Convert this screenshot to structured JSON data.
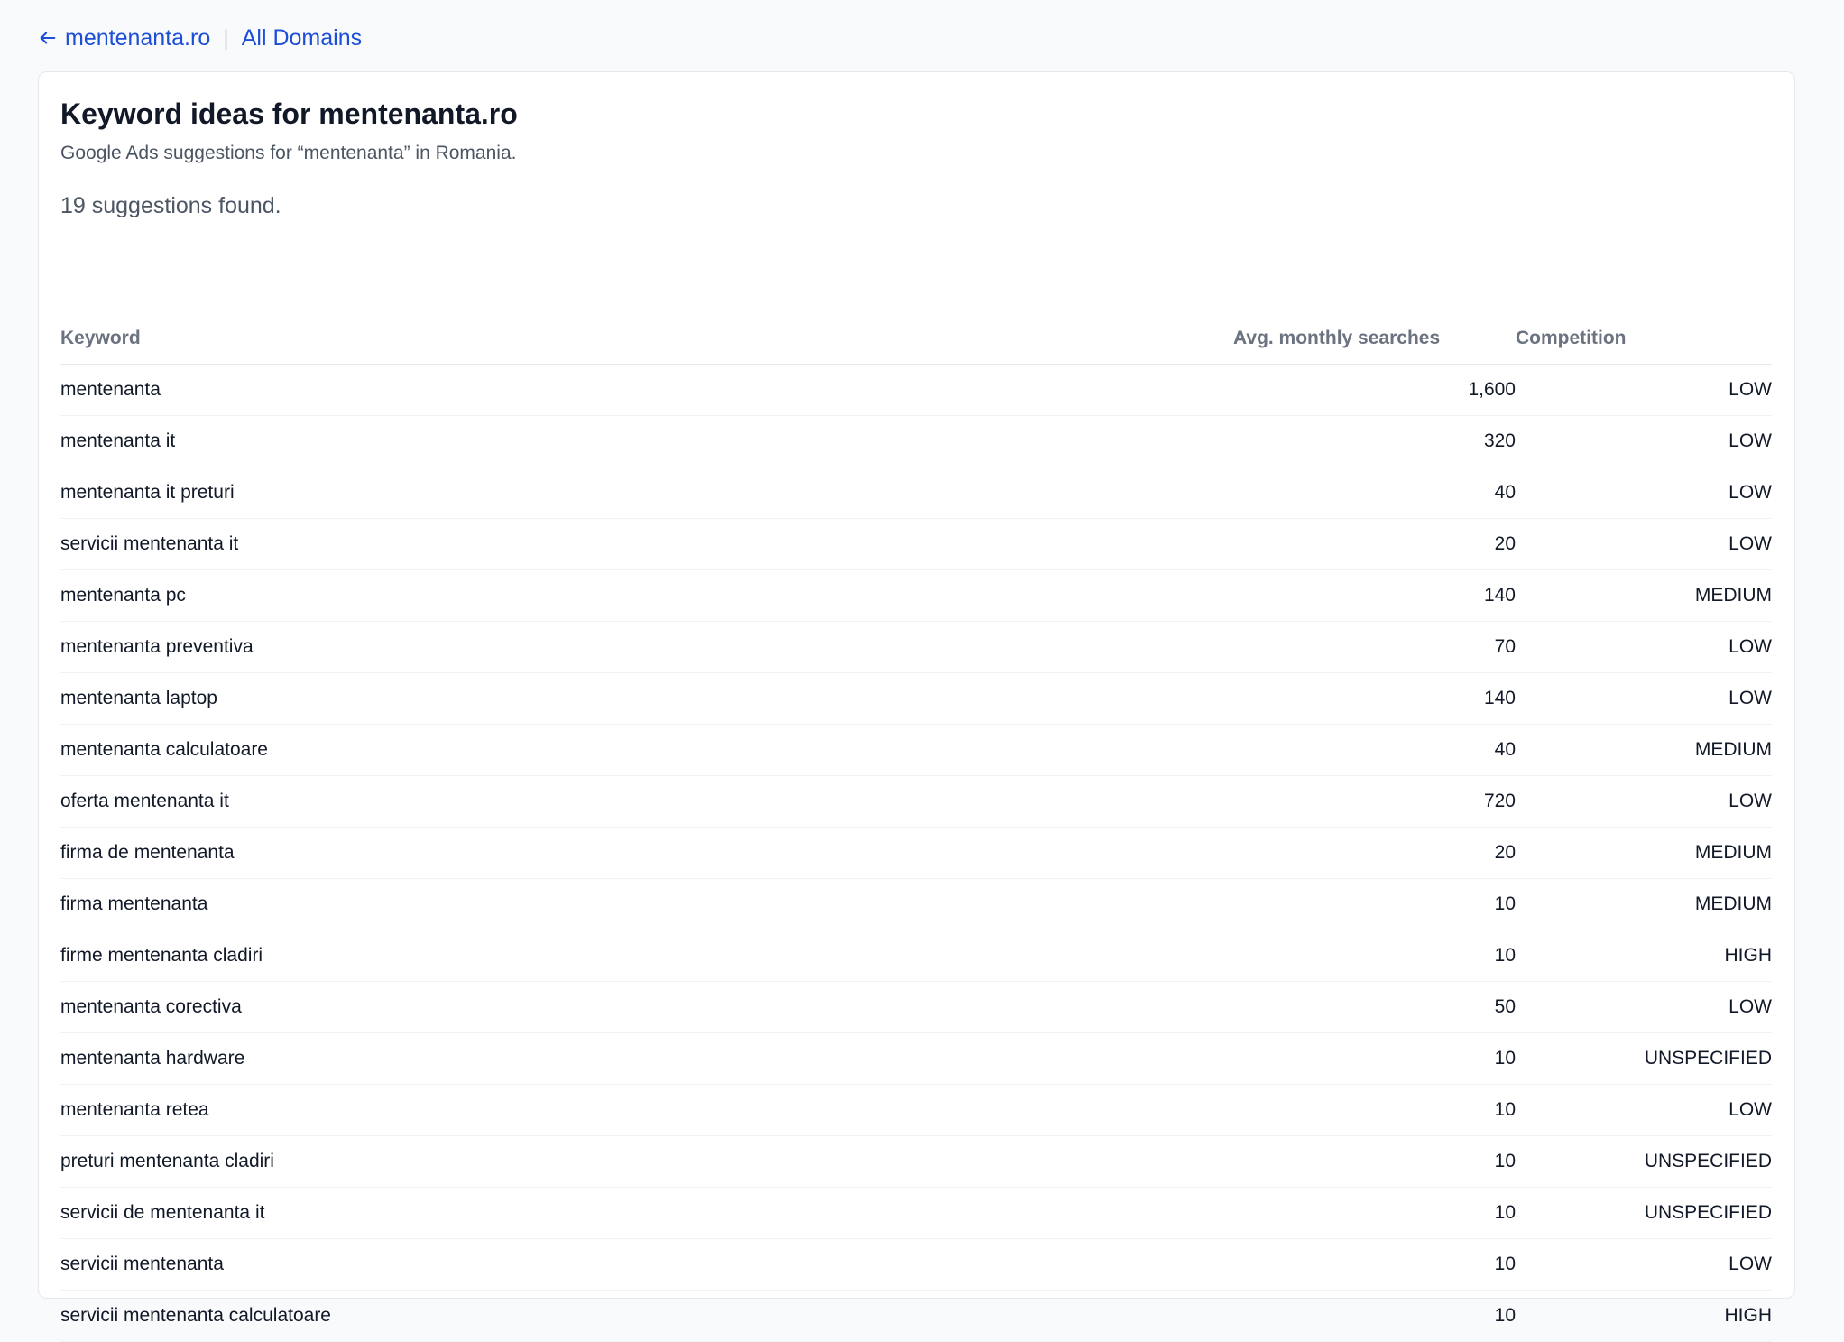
{
  "nav": {
    "back_label": "mentenanta.ro",
    "separator": "|",
    "all_domains_label": "All Domains"
  },
  "header": {
    "title": "Keyword ideas for mentenanta.ro",
    "subtitle": "Google Ads suggestions for “mentenanta” in Romania.",
    "count_text": "19 suggestions found."
  },
  "table": {
    "columns": {
      "keyword": "Keyword",
      "searches": "Avg. monthly searches",
      "competition": "Competition"
    },
    "rows": [
      {
        "keyword": "mentenanta",
        "searches": "1,600",
        "competition": "LOW"
      },
      {
        "keyword": "mentenanta it",
        "searches": "320",
        "competition": "LOW"
      },
      {
        "keyword": "mentenanta it preturi",
        "searches": "40",
        "competition": "LOW"
      },
      {
        "keyword": "servicii mentenanta it",
        "searches": "20",
        "competition": "LOW"
      },
      {
        "keyword": "mentenanta pc",
        "searches": "140",
        "competition": "MEDIUM"
      },
      {
        "keyword": "mentenanta preventiva",
        "searches": "70",
        "competition": "LOW"
      },
      {
        "keyword": "mentenanta laptop",
        "searches": "140",
        "competition": "LOW"
      },
      {
        "keyword": "mentenanta calculatoare",
        "searches": "40",
        "competition": "MEDIUM"
      },
      {
        "keyword": "oferta mentenanta it",
        "searches": "720",
        "competition": "LOW"
      },
      {
        "keyword": "firma de mentenanta",
        "searches": "20",
        "competition": "MEDIUM"
      },
      {
        "keyword": "firma mentenanta",
        "searches": "10",
        "competition": "MEDIUM"
      },
      {
        "keyword": "firme mentenanta cladiri",
        "searches": "10",
        "competition": "HIGH"
      },
      {
        "keyword": "mentenanta corectiva",
        "searches": "50",
        "competition": "LOW"
      },
      {
        "keyword": "mentenanta hardware",
        "searches": "10",
        "competition": "UNSPECIFIED"
      },
      {
        "keyword": "mentenanta retea",
        "searches": "10",
        "competition": "LOW"
      },
      {
        "keyword": "preturi mentenanta cladiri",
        "searches": "10",
        "competition": "UNSPECIFIED"
      },
      {
        "keyword": "servicii de mentenanta it",
        "searches": "10",
        "competition": "UNSPECIFIED"
      },
      {
        "keyword": "servicii mentenanta",
        "searches": "10",
        "competition": "LOW"
      },
      {
        "keyword": "servicii mentenanta calculatoare",
        "searches": "10",
        "competition": "HIGH"
      }
    ]
  },
  "colors": {
    "link": "#1d4ed8",
    "background": "#f9fafb",
    "card": "#ffffff",
    "border": "#e5e7eb",
    "muted_text": "#6b7280"
  },
  "icons": {
    "back": "arrow-left-icon"
  }
}
